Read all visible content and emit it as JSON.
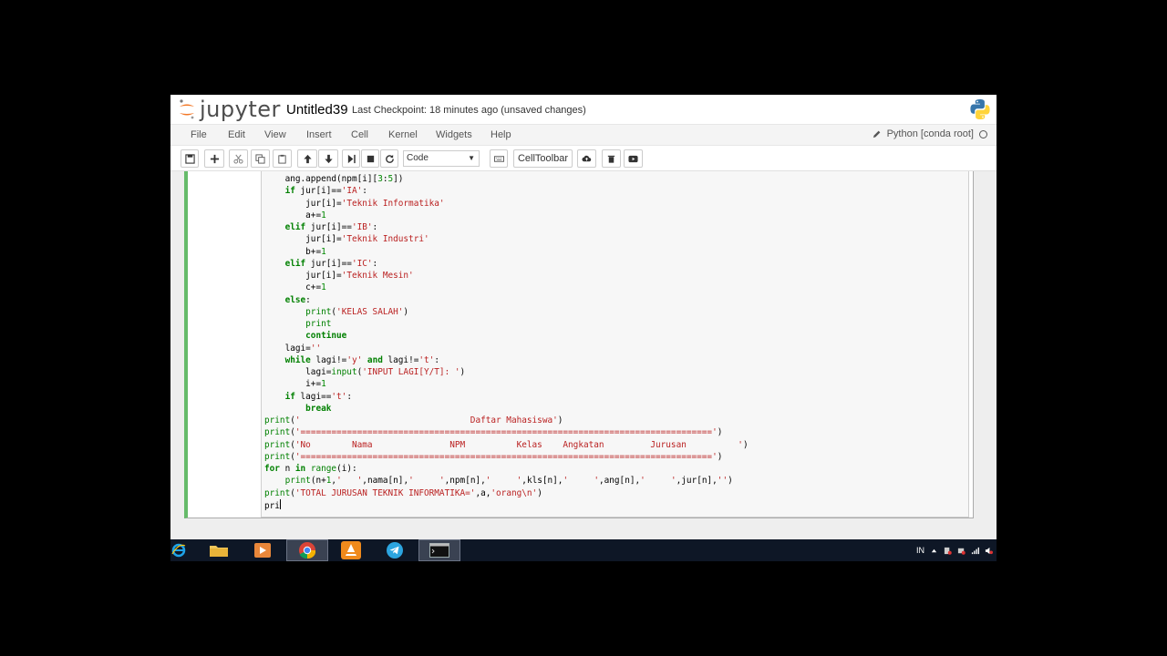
{
  "header": {
    "logo_text": "jupyter",
    "notebook_title": "Untitled39",
    "checkpoint": "Last Checkpoint: 18 minutes ago (unsaved changes)"
  },
  "menubar": {
    "items": [
      "File",
      "Edit",
      "View",
      "Insert",
      "Cell",
      "Kernel",
      "Widgets",
      "Help"
    ],
    "kernel_name": "Python [conda root]"
  },
  "toolbar": {
    "cell_type": "Code",
    "celltoolbar_label": "CellToolbar"
  },
  "code_lines": [
    "    ang.append(npm[i][3:5])",
    "    if jur[i]=='IA':",
    "        jur[i]='Teknik Informatika'",
    "        a+=1",
    "    elif jur[i]=='IB':",
    "        jur[i]='Teknik Industri'",
    "        b+=1",
    "    elif jur[i]=='IC':",
    "        jur[i]='Teknik Mesin'",
    "        c+=1",
    "    else:",
    "        print('KELAS SALAH')",
    "        print",
    "        continue",
    "    lagi=''",
    "    while lagi!='y' and lagi!='t':",
    "        lagi=input('INPUT LAGI[Y/T]: ')",
    "        i+=1",
    "    if lagi=='t':",
    "        break",
    "print('                                 Daftar Mahasiswa')",
    "print('================================================================================')",
    "print('No        Nama               NPM          Kelas    Angkatan         Jurusan          ')",
    "print('================================================================================')",
    "for n in range(i):",
    "    print(n+1,'   ',nama[n],'     ',npm[n],'     ',kls[n],'     ',ang[n],'     ',jur[n],'')",
    "print('TOTAL JURUSAN TEKNIK INFORMATIKA=',a,'orang\\n')",
    "pri"
  ],
  "taskbar": {
    "apps": [
      "internet-explorer",
      "file-explorer",
      "media-player",
      "chrome",
      "vlc",
      "telegram",
      "command-prompt"
    ],
    "language": "IN"
  }
}
